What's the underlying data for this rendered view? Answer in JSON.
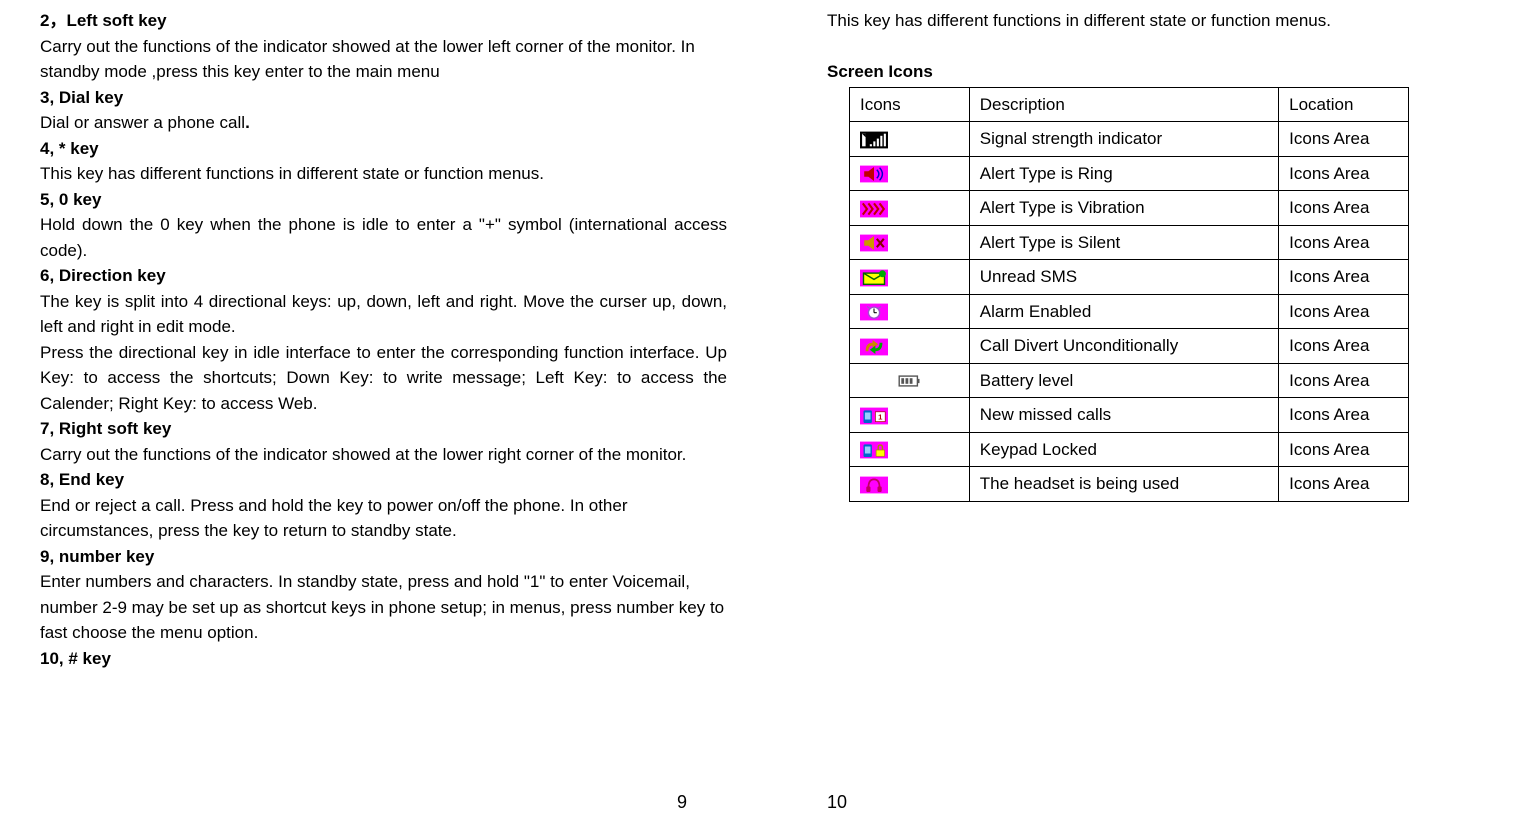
{
  "left": {
    "s1_title": "2，Left soft key",
    "s1_body": "Carry out the functions of the indicator showed at the lower left corner of the monitor. In standby mode ,press this key enter to the main menu",
    "s2_title": "3, Dial key",
    "s2_body": "Dial or answer a phone call",
    "s3_title": "4, * key",
    "s3_body": "This key has different functions in different state or function menus.",
    "s4_title": "5, 0 key",
    "s4_body": "Hold down the 0 key when the phone is idle to enter a \"+\" symbol (international access code).",
    "s5_title": "6, Direction key",
    "s5_body1": "The key is split into 4 directional keys: up, down, left and right. Move the curser up, down, left and right in edit mode.",
    "s5_body2": "Press the directional key in idle interface to enter the corresponding function interface. Up Key: to access the shortcuts; Down Key: to write message; Left Key: to access the Calender; Right Key: to access Web.",
    "s6_title": "7, Right soft key",
    "s6_body": "Carry out the functions of the indicator showed at the lower right corner of the monitor.",
    "s7_title": "8, End key",
    "s7_body": "End or reject a call. Press and hold the key to power on/off the phone. In other circumstances, press the key to return to standby state.",
    "s8_title": "9, number key",
    "s8_body": "Enter numbers and characters. In standby state, press and hold \"1\" to enter Voicemail, number 2-9 may be set up as shortcut keys in phone setup; in menus, press number key to fast choose the menu option.",
    "s9_title": "10, # key",
    "page_num": "9"
  },
  "right": {
    "intro": "This key has different functions in different state or function menus.",
    "heading": "Screen Icons",
    "th1": "Icons",
    "th2": "Description",
    "th3": "Location",
    "rows": {
      "r0": {
        "desc": "Signal strength indicator",
        "loc": "Icons Area",
        "icon": "signal"
      },
      "r1": {
        "desc": "Alert Type is Ring",
        "loc": "Icons Area",
        "icon": "ring"
      },
      "r2": {
        "desc": "Alert Type is Vibration",
        "loc": "Icons Area",
        "icon": "vibration"
      },
      "r3": {
        "desc": " Alert Type is Silent",
        "loc": "Icons Area",
        "icon": "silent"
      },
      "r4": {
        "desc": "Unread SMS",
        "loc": "Icons Area",
        "icon": "sms"
      },
      "r5": {
        "desc": "Alarm Enabled",
        "loc": "Icons Area",
        "icon": "alarm"
      },
      "r6": {
        "desc": "Call Divert Unconditionally",
        "loc": "Icons Area",
        "icon": "divert"
      },
      "r7": {
        "desc": "Battery level",
        "loc": "Icons Area",
        "icon": "battery"
      },
      "r8": {
        "desc": "New missed calls",
        "loc": "Icons Area",
        "icon": "missed"
      },
      "r9": {
        "desc": "Keypad Locked",
        "loc": "Icons Area",
        "icon": "lock"
      },
      "r10": {
        "desc": "The headset is being used",
        "loc": "Icons Area",
        "icon": "headset"
      }
    },
    "page_num": "10"
  }
}
